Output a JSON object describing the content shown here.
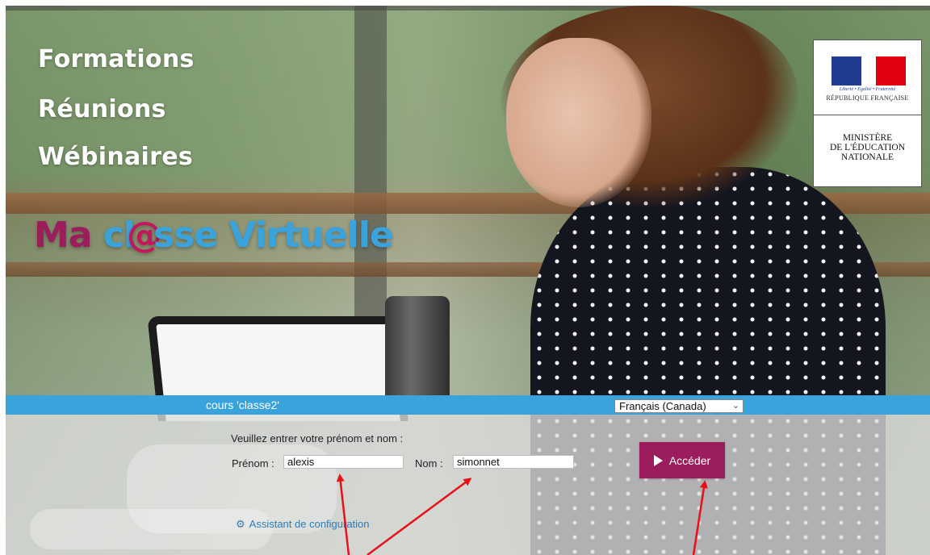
{
  "hero": {
    "formations": "Formations",
    "reunions": "Réunions",
    "webinaires": "Wébinaires",
    "brand_ma": "Ma",
    "brand_cl": "cl",
    "brand_at": "@",
    "brand_sse": "sse",
    "brand_virtuelle": "Virtuelle"
  },
  "logo": {
    "motto": "Liberté • Égalité • Fraternité",
    "republic": "RÉPUBLIQUE FRANÇAISE",
    "ministry_line1": "MINISTÈRE",
    "ministry_line2": "DE L'ÉDUCATION",
    "ministry_line3": "NATIONALE"
  },
  "bar": {
    "course": "cours 'classe2'",
    "language": "Français (Canada)"
  },
  "form": {
    "title": "Veuillez entrer votre prénom et nom :",
    "prenom_label": "Prénom :",
    "prenom_value": "alexis",
    "nom_label": "Nom :",
    "nom_value": "simonnet",
    "submit_label": "Accéder",
    "assistant_label": "Assistant de configuration"
  },
  "colors": {
    "brand_ma": "#9c1d5b",
    "brand_at": "#c2185b",
    "brand_rest": "#3ba3dc",
    "bar": "#3ba3dc",
    "button": "#9c1d5b",
    "arrows": "#e8101a"
  },
  "icons": {
    "play": "play-icon",
    "gear": "gear-icon",
    "chevron": "chevron-down-icon"
  }
}
